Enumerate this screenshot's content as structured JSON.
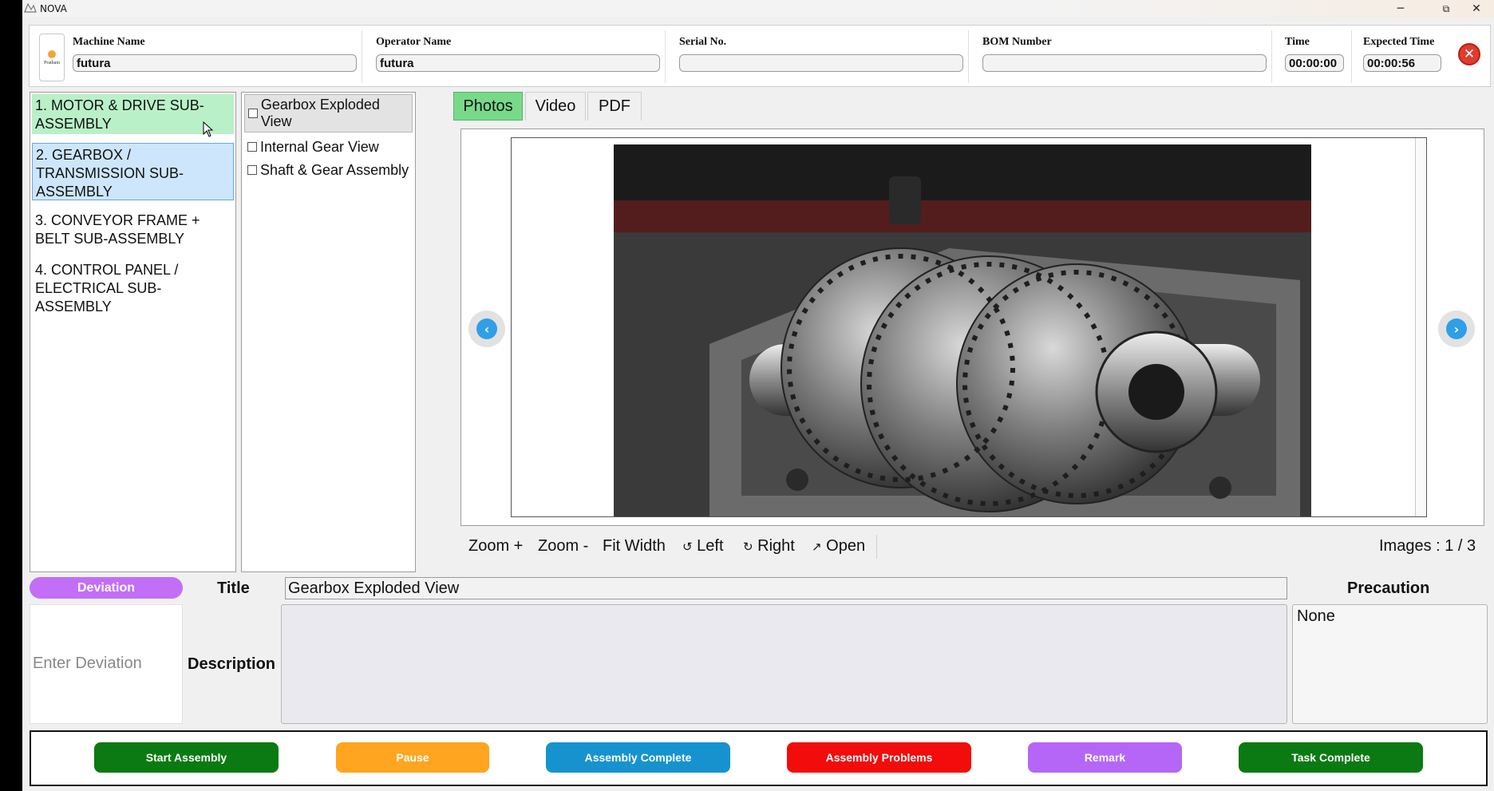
{
  "window": {
    "title": "NOVA",
    "controls": {
      "minimize": "─",
      "restore": "⧉",
      "close": "✕"
    }
  },
  "header": {
    "logo_text": "Pratham",
    "fields": [
      {
        "label": "Machine Name",
        "value": "futura"
      },
      {
        "label": "Operator Name",
        "value": "futura"
      },
      {
        "label": "Serial No.",
        "value": ""
      },
      {
        "label": "BOM Number",
        "value": ""
      },
      {
        "label": "Time",
        "value": "00:00:00"
      },
      {
        "label": "Expected Time",
        "value": "00:00:56"
      }
    ],
    "close_glyph": "✕"
  },
  "steps": [
    {
      "label": "1. MOTOR & DRIVE SUB-ASSEMBLY",
      "state": "hover"
    },
    {
      "label": "2. GEARBOX / TRANSMISSION SUB-ASSEMBLY",
      "state": "selected"
    },
    {
      "label": "3. CONVEYOR FRAME + BELT SUB-ASSEMBLY",
      "state": "normal"
    },
    {
      "label": "4. CONTROL PANEL / ELECTRICAL SUB-ASSEMBLY",
      "state": "normal"
    }
  ],
  "sub_items": [
    {
      "label": "Gearbox Exploded View",
      "checked": false,
      "selected": true
    },
    {
      "label": "Internal Gear View",
      "checked": false,
      "selected": false
    },
    {
      "label": "Shaft & Gear Assembly",
      "checked": false,
      "selected": false
    }
  ],
  "tabs": [
    {
      "label": "Photos",
      "active": true
    },
    {
      "label": "Video",
      "active": false
    },
    {
      "label": "PDF",
      "active": false
    }
  ],
  "viewer": {
    "prev_glyph": "‹",
    "next_glyph": "›",
    "image_subject": "gearbox gears photo"
  },
  "toolbar": {
    "zoom_in": "Zoom +",
    "zoom_out": "Zoom -",
    "fit_width": "Fit Width",
    "rotate_left": "Left",
    "rotate_right": "Right",
    "open": "Open",
    "rotate_left_glyph": "↺",
    "rotate_right_glyph": "↻",
    "open_glyph": "↗",
    "image_count": "Images : 1 / 3"
  },
  "details": {
    "deviation_label": "Deviation",
    "deviation_placeholder": "Enter Deviation",
    "title_label": "Title",
    "title_value": "Gearbox Exploded View",
    "description_label": "Description",
    "description_value": "",
    "precaution_label": "Precaution",
    "precaution_value": "None"
  },
  "actions": [
    {
      "label": "Start Assembly",
      "color": "#0b7a12"
    },
    {
      "label": "Pause",
      "color": "#ffa51f"
    },
    {
      "label": "Assembly Complete",
      "color": "#1693cf"
    },
    {
      "label": "Assembly Problems",
      "color": "#f20c0c"
    },
    {
      "label": "Remark",
      "color": "#b566f7"
    },
    {
      "label": "Task Complete",
      "color": "#0b7a12"
    }
  ]
}
